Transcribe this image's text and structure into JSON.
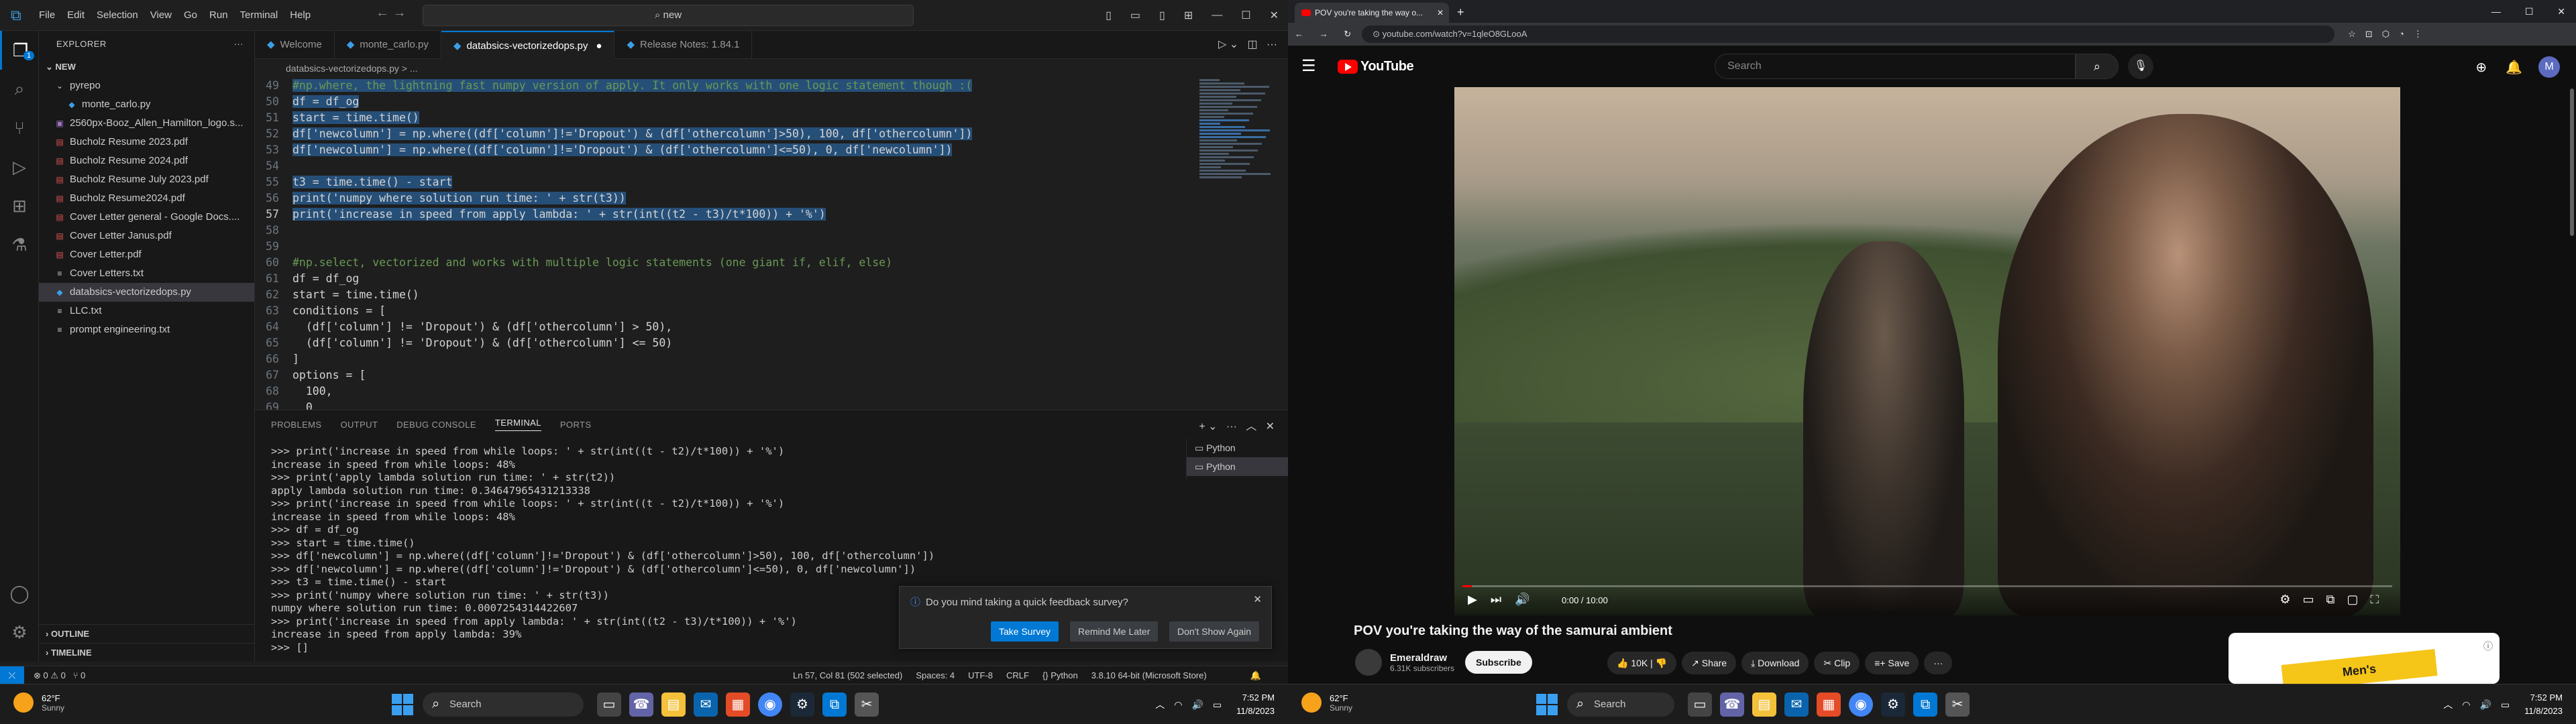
{
  "vscode": {
    "menu": [
      "File",
      "Edit",
      "Selection",
      "View",
      "Go",
      "Run",
      "Terminal",
      "Help"
    ],
    "search": "new",
    "explorer_header": "EXPLORER",
    "folder": "NEW",
    "tree": [
      {
        "label": "pyrepo",
        "icon": "folder",
        "indent": 1
      },
      {
        "label": "monte_carlo.py",
        "icon": "python",
        "indent": 2
      },
      {
        "label": "2560px-Booz_Allen_Hamilton_logo.s...",
        "icon": "image",
        "indent": 1
      },
      {
        "label": "Bucholz Resume 2023.pdf",
        "icon": "pdf",
        "indent": 1
      },
      {
        "label": "Bucholz Resume 2024.pdf",
        "icon": "pdf",
        "indent": 1
      },
      {
        "label": "Bucholz Resume July 2023.pdf",
        "icon": "pdf",
        "indent": 1
      },
      {
        "label": "Bucholz Resume2024.pdf",
        "icon": "pdf",
        "indent": 1
      },
      {
        "label": "Cover Letter general - Google Docs....",
        "icon": "pdf",
        "indent": 1
      },
      {
        "label": "Cover Letter Janus.pdf",
        "icon": "pdf",
        "indent": 1
      },
      {
        "label": "Cover Letter.pdf",
        "icon": "pdf",
        "indent": 1
      },
      {
        "label": "Cover Letters.txt",
        "icon": "text",
        "indent": 1
      },
      {
        "label": "databsics-vectorizedops.py",
        "icon": "python",
        "indent": 1,
        "selected": true
      },
      {
        "label": "LLC.txt",
        "icon": "text",
        "indent": 1
      },
      {
        "label": "prompt engineering.txt",
        "icon": "text",
        "indent": 1
      }
    ],
    "outline": "OUTLINE",
    "timeline": "TIMELINE",
    "tabs": [
      {
        "label": "Welcome"
      },
      {
        "label": "monte_carlo.py"
      },
      {
        "label": "databsics-vectorizedops.py",
        "active": true,
        "dirty": true
      },
      {
        "label": "Release Notes: 1.84.1"
      }
    ],
    "breadcrumb": "databsics-vectorizedops.py > ...",
    "code_lines": [
      {
        "n": "49",
        "t": "#np.where, the lightning fast numpy version of apply. It only works with one logic statement though :(",
        "sel": true
      },
      {
        "n": "50",
        "t": "df = df_og",
        "sel": true
      },
      {
        "n": "51",
        "t": "start = time.time()",
        "sel": true
      },
      {
        "n": "52",
        "t": "df['newcolumn'] = np.where((df['column']!='Dropout') & (df['othercolumn']>50), 100, df['othercolumn'])",
        "sel": true
      },
      {
        "n": "53",
        "t": "df['newcolumn'] = np.where((df['column']!='Dropout') & (df['othercolumn']<=50), 0, df['newcolumn'])",
        "sel": true
      },
      {
        "n": "54",
        "t": "",
        "sel": true
      },
      {
        "n": "55",
        "t": "t3 = time.time() - start",
        "sel": true
      },
      {
        "n": "56",
        "t": "print('numpy where solution run time: ' + str(t3))",
        "sel": true
      },
      {
        "n": "57",
        "t": "print('increase in speed from apply lambda: ' + str(int((t2 - t3)/t*100)) + '%')",
        "sel": true,
        "cur": true
      },
      {
        "n": "58",
        "t": ""
      },
      {
        "n": "59",
        "t": ""
      },
      {
        "n": "60",
        "t": "#np.select, vectorized and works with multiple logic statements (one giant if, elif, else)"
      },
      {
        "n": "61",
        "t": "df = df_og"
      },
      {
        "n": "62",
        "t": "start = time.time()"
      },
      {
        "n": "63",
        "t": "conditions = ["
      },
      {
        "n": "64",
        "t": "  (df['column'] != 'Dropout') & (df['othercolumn'] > 50),"
      },
      {
        "n": "65",
        "t": "  (df['column'] != 'Dropout') & (df['othercolumn'] <= 50)"
      },
      {
        "n": "66",
        "t": "]"
      },
      {
        "n": "67",
        "t": "options = ["
      },
      {
        "n": "68",
        "t": "  100,"
      },
      {
        "n": "69",
        "t": "  0"
      }
    ],
    "panel_tabs": [
      "PROBLEMS",
      "OUTPUT",
      "DEBUG CONSOLE",
      "TERMINAL",
      "PORTS"
    ],
    "terminal_lines": [
      ">>> print('increase in speed from while loops: ' + str(int((t - t2)/t*100)) + '%')",
      "increase in speed from while loops: 48%",
      ">>> print('apply lambda solution run time: ' + str(t2))",
      "apply lambda solution run time: 0.34647965431213338",
      ">>> print('increase in speed from while loops: ' + str(int((t - t2)/t*100)) + '%')",
      "increase in speed from while loops: 48%",
      ">>> df = df_og",
      ">>> start = time.time()",
      ">>> df['newcolumn'] = np.where((df['column']!='Dropout') & (df['othercolumn']>50), 100, df['othercolumn'])",
      ">>> df['newcolumn'] = np.where((df['column']!='Dropout') & (df['othercolumn']<=50), 0, df['newcolumn'])",
      ">>> t3 = time.time() - start",
      ">>> print('numpy where solution run time: ' + str(t3))",
      "numpy where solution run time: 0.0007254314422607",
      ">>> print('increase in speed from apply lambda: ' + str(int((t2 - t3)/t*100)) + '%')",
      "increase in speed from apply lambda: 39%",
      ">>> []"
    ],
    "terminals": [
      "Python",
      "Python"
    ],
    "toast": {
      "message": "Do you mind taking a quick feedback survey?",
      "take": "Take Survey",
      "later": "Remind Me Later",
      "dont": "Don't Show Again"
    },
    "status": {
      "problems": "⊗ 0 ⚠ 0",
      "ports": "⑂ 0",
      "items": [
        "Ln 57, Col 81 (502 selected)",
        "Spaces: 4",
        "UTF-8",
        "CRLF",
        "{} Python",
        "3.8.10 64-bit (Microsoft Store)"
      ]
    }
  },
  "chrome": {
    "tab_title": "POV you're taking the way o...",
    "url": "youtube.com/watch?v=1qleO8GLooA",
    "search_placeholder": "Search",
    "avatar": "M",
    "video_title": "POV you're taking the way of the samurai ambient",
    "channel": "Emeraldraw",
    "subscribers": "6.31K subscribers",
    "subscribe": "Subscribe",
    "likes": "10K",
    "share": "Share",
    "download": "Download",
    "clip": "Clip",
    "save": "Save",
    "ad_text": "Men's",
    "time": "0:00 / 10:00",
    "progress_percent": 1
  },
  "taskbar": {
    "left": {
      "temp": "62°F",
      "cond": "Sunny",
      "search": "Search",
      "time": "7:52 PM",
      "date": "11/8/2023"
    },
    "right": {
      "temp": "62°F",
      "cond": "Sunny",
      "search": "Search",
      "time": "7:52 PM",
      "date": "11/8/2023"
    }
  }
}
